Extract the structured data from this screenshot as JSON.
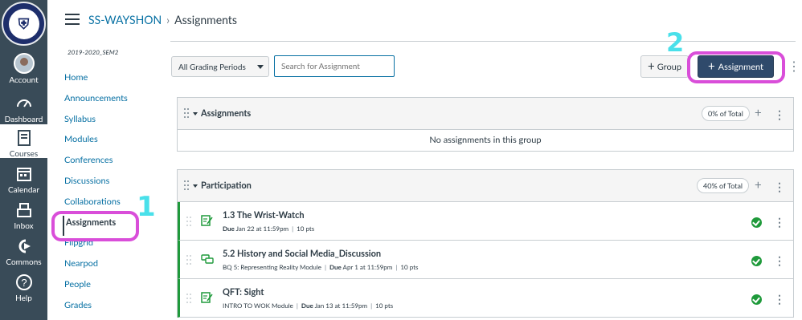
{
  "global_nav": {
    "items": [
      {
        "label": "Account",
        "icon": "avatar"
      },
      {
        "label": "Dashboard",
        "icon": "dashboard-icon"
      },
      {
        "label": "Courses",
        "icon": "courses-icon"
      },
      {
        "label": "Calendar",
        "icon": "calendar-icon"
      },
      {
        "label": "Inbox",
        "icon": "inbox-icon"
      },
      {
        "label": "Commons",
        "icon": "commons-icon"
      },
      {
        "label": "Help",
        "icon": "help-icon"
      }
    ],
    "active": "Courses",
    "bg_color": "#394b58"
  },
  "breadcrumb": {
    "course": "SS-WAYSHON",
    "separator": "›",
    "page": "Assignments"
  },
  "course_nav": {
    "term": "2019-2020_SEM2",
    "items": [
      "Home",
      "Announcements",
      "Syllabus",
      "Modules",
      "Conferences",
      "Discussions",
      "Collaborations",
      "Assignments",
      "Flipgrid",
      "Nearpod",
      "People",
      "Grades"
    ],
    "active": "Assignments"
  },
  "toolbar": {
    "grading_period": "All Grading Periods",
    "search_placeholder": "Search for Assignment",
    "group_label": "Group",
    "assignment_label": "Assignment"
  },
  "groups": [
    {
      "title": "Assignments",
      "weight": "0% of Total",
      "empty_text": "No assignments in this group"
    },
    {
      "title": "Participation",
      "weight": "40% of Total",
      "items": [
        {
          "title": "1.3 The Wrist-Watch",
          "module": "",
          "due": "Due",
          "due_date": "Jan 22 at 11:59pm",
          "points": "10 pts",
          "type": "assignment"
        },
        {
          "title": "5.2 History and Social Media_Discussion",
          "module": "BQ 5: Representing Reality Module",
          "due": "Due",
          "due_date": "Apr 1 at 11:59pm",
          "points": "10 pts",
          "type": "discussion"
        },
        {
          "title": "QFT: Sight",
          "module": "INTRO TO WOK Module",
          "due": "Due",
          "due_date": "Jan 13 at 11:59pm",
          "points": "10 pts",
          "type": "assignment"
        }
      ]
    }
  ],
  "annotations": {
    "one": "1",
    "two": "2"
  },
  "colors": {
    "accent": "#0770a3",
    "primary_button": "#2f4a6b",
    "published": "#1f9a3b",
    "highlight": "#d94ed9",
    "annotation_number": "#49e0ea"
  }
}
